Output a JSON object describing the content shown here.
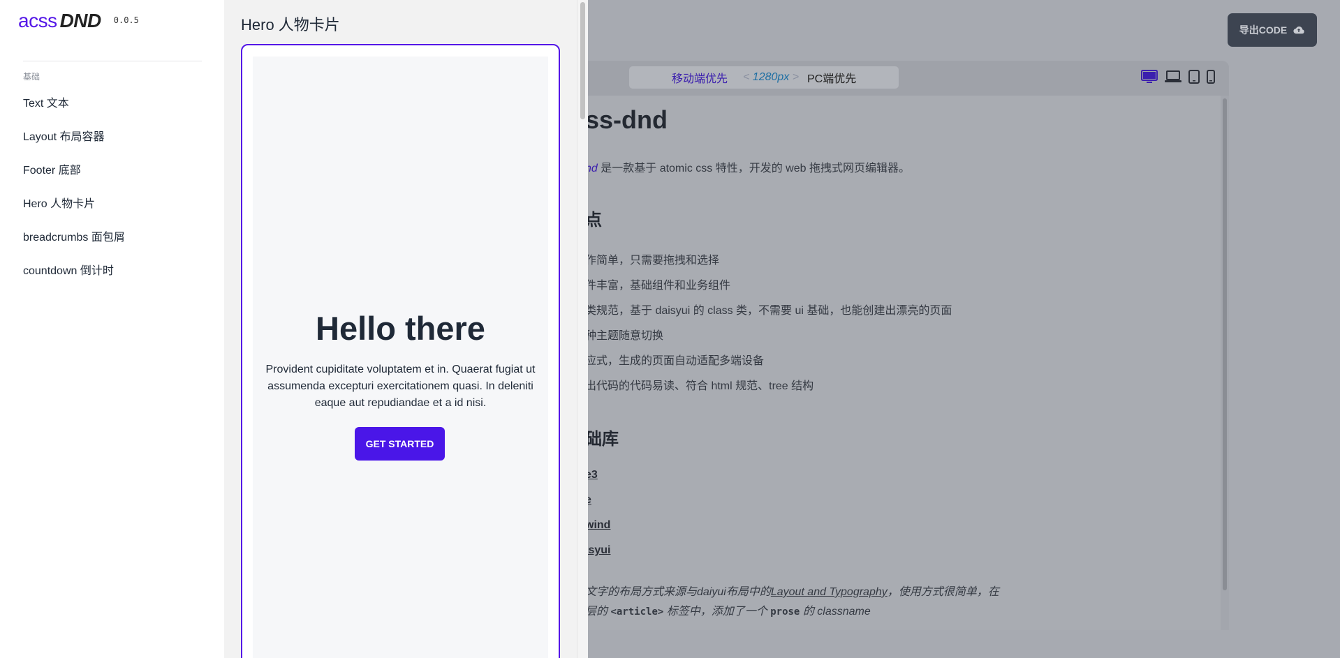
{
  "app": {
    "logo_part1": "acss",
    "logo_part2": "DND",
    "version": "0.0.5"
  },
  "toolbar": {
    "export_label": "导出CODE"
  },
  "breakpoints": {
    "mobile_first": "移动端优先",
    "px_open": "<",
    "px_value": "1280px",
    "px_close": ">",
    "pc_first": "PC端优先"
  },
  "devices": [
    "desktop-icon",
    "laptop-icon",
    "tablet-icon",
    "mobile-icon"
  ],
  "canvas": {
    "heading": "ss-dnd",
    "intro_em": "nd",
    "intro_text": " 是一款基于 atomic css 特性，开发的 web 拖拽式网页编辑器。",
    "features_heading": "点",
    "features": [
      "作简单，只需要拖拽和选择",
      "件丰富，基础组件和业务组件",
      " 类规范，基于 daisyui 的 class 类，不需要 ui 基础，也能创建出漂亮的页面",
      "种主题随意切换",
      "应式，生成的页面自动适配多端设备",
      "出代码的代码易读、符合 html 规范、tree 结构"
    ],
    "libs_heading": "础库",
    "libs": [
      "e3",
      "e",
      "wind",
      "isyui"
    ],
    "note_line1_a": "文字的布局方式来源与daiyui布局中的",
    "note_line1_link": "Layout and Typography",
    "note_line1_b": "，使用方式很简单，在",
    "note_line2_a": "层的 ",
    "note_line2_code1": "<article>",
    "note_line2_b": " 标签中，添加了一个 ",
    "note_line2_code2": "prose",
    "note_line2_c": " 的 classname"
  },
  "sidebar": {
    "section_title": "基础",
    "items": [
      {
        "label": "Text 文本"
      },
      {
        "label": "Layout 布局容器"
      },
      {
        "label": "Footer 底部"
      },
      {
        "label": "Hero 人物卡片"
      },
      {
        "label": "breadcrumbs 面包屑"
      },
      {
        "label": "countdown 倒计时"
      }
    ]
  },
  "preview": {
    "title": "Hero 人物卡片",
    "hero_heading": "Hello there",
    "hero_text": "Provident cupiditate voluptatem et in. Quaerat fugiat ut assumenda excepturi exercitationem quasi. In deleniti eaque aut repudiandae et a id nisi.",
    "hero_button": "GET STARTED"
  },
  "colors": {
    "brand": "#5417e7",
    "button": "#4a16e8",
    "overlay": "#a7aab1"
  }
}
